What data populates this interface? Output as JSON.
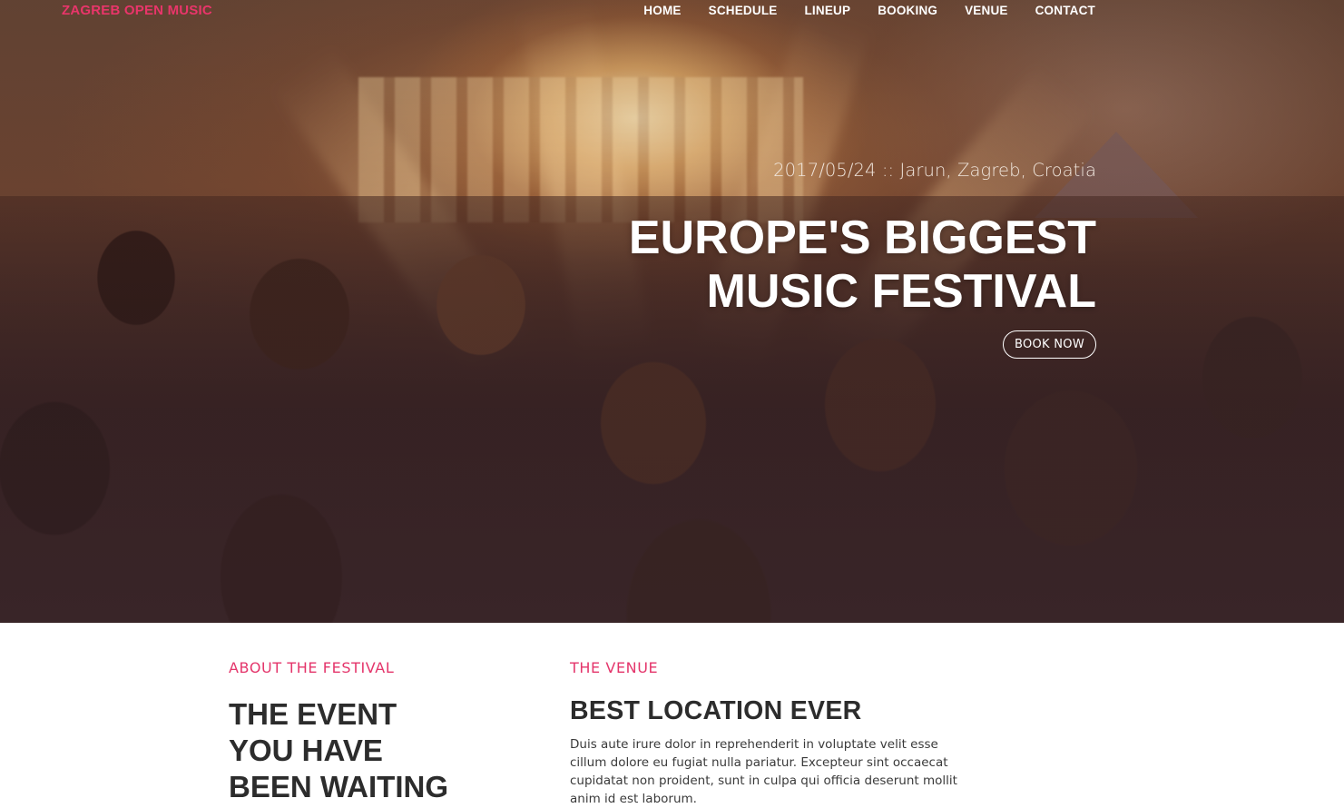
{
  "brand": {
    "name": "ZAGREB OPEN MUSIC",
    "color": "#e9356a"
  },
  "nav": {
    "items": [
      {
        "label": "HOME"
      },
      {
        "label": "SCHEDULE"
      },
      {
        "label": "LINEUP"
      },
      {
        "label": "BOOKING"
      },
      {
        "label": "VENUE"
      },
      {
        "label": "CONTACT"
      }
    ]
  },
  "hero": {
    "date_location": "2017/05/24 :: Jarun, Zagreb, Croatia",
    "title_line1": "EUROPE'S BIGGEST",
    "title_line2": "MUSIC FESTIVAL",
    "cta_label": "BOOK NOW"
  },
  "about": {
    "eyebrow": "ABOUT THE FESTIVAL",
    "heading_line1": "THE EVENT",
    "heading_line2": "YOU HAVE",
    "heading_line3": "BEEN WAITING"
  },
  "venue": {
    "eyebrow": "THE VENUE",
    "heading": "BEST LOCATION EVER",
    "body": "Duis aute irure dolor in reprehenderit in voluptate velit esse cillum dolore eu fugiat nulla pariatur. Excepteur sint occaecat cupidatat non proident, sunt in culpa qui officia deserunt mollit anim id est laborum."
  },
  "colors": {
    "accent": "#e4356b",
    "heading_text": "#2c2c2c"
  }
}
